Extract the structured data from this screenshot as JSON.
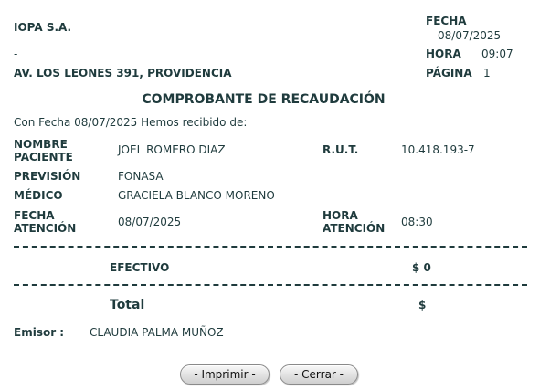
{
  "header": {
    "company": "IOPA S.A.",
    "dash": "-",
    "address": "AV. LOS LEONES 391, PROVIDENCIA",
    "fecha_label": "FECHA",
    "fecha_value": "08/07/2025",
    "hora_label": "HORA",
    "hora_value": "09:07",
    "pagina_label": "PÁGINA",
    "pagina_value": "1"
  },
  "title": "COMPROBANTE DE RECAUDACIÓN",
  "intro": "Con Fecha 08/07/2025 Hemos recibido de:",
  "patient": {
    "nombre_label_1": "NOMBRE",
    "nombre_label_2": "PACIENTE",
    "nombre_value": "JOEL ROMERO DIAZ",
    "rut_label": "R.U.T.",
    "rut_value": "10.418.193-7",
    "prevision_label": "PREVISIÓN",
    "prevision_value": "FONASA",
    "medico_label": "MÉDICO",
    "medico_value": "GRACIELA BLANCO MORENO",
    "fecha_label_1": "FECHA",
    "fecha_label_2": "ATENCIÓN",
    "fecha_value": "08/07/2025",
    "hora_label_1": "HORA",
    "hora_label_2": "ATENCIÓN",
    "hora_value": "08:30"
  },
  "payment": {
    "method": "EFECTIVO",
    "amount": "$ 0",
    "total_label": "Total",
    "total_value": "$"
  },
  "emisor": {
    "label": "Emisor :",
    "value": "CLAUDIA PALMA MUÑOZ"
  },
  "buttons": {
    "print": "- Imprimir -",
    "close": "- Cerrar -"
  },
  "colors": {
    "text": "#1f3b3d",
    "button_border": "#8a8a8a"
  }
}
